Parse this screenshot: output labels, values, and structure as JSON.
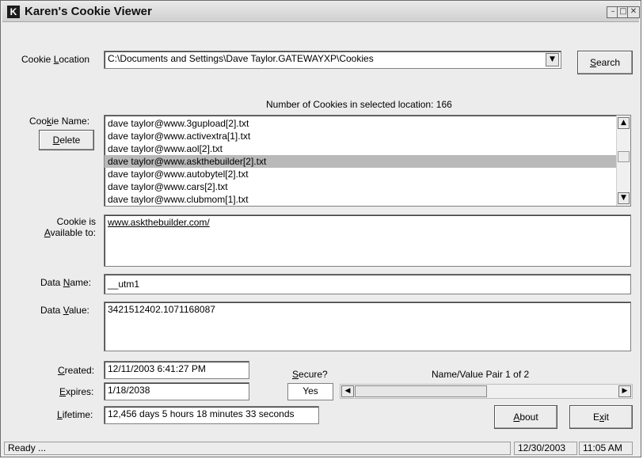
{
  "window": {
    "icon_letter": "K",
    "title": "Karen's Cookie Viewer",
    "controls": [
      "minimize",
      "maximize",
      "close"
    ]
  },
  "location": {
    "label_pre": "Cookie ",
    "label_ul": "L",
    "label_post": "ocation",
    "value": "C:\\Documents and Settings\\Dave Taylor.GATEWAYXP\\Cookies",
    "search_pre": "",
    "search_ul": "S",
    "search_post": "earch"
  },
  "count_text": "Number of Cookies in selected location: 166",
  "cookie_name": {
    "label_pre": "Coo",
    "label_ul": "k",
    "label_post": "ie Name:",
    "delete_ul": "D",
    "delete_post": "elete",
    "items": [
      "dave taylor@www.3gupload[2].txt",
      "dave taylor@www.activextra[1].txt",
      "dave taylor@www.aol[2].txt",
      "dave taylor@www.askthebuilder[2].txt",
      "dave taylor@www.autobytel[2].txt",
      "dave taylor@www.cars[2].txt",
      "dave taylor@www.clubmom[1].txt"
    ],
    "selected_index": 3
  },
  "available": {
    "label_line1": "Cookie is",
    "label_line2_ul": "A",
    "label_line2_post": "vailable to:",
    "value": "www.askthebuilder.com/"
  },
  "data_name": {
    "label_pre": "Data ",
    "label_ul": "N",
    "label_post": "ame:",
    "value": "__utm1"
  },
  "data_value": {
    "label_pre": "Data ",
    "label_ul": "V",
    "label_post": "alue:",
    "value": "3421512402.1071168087"
  },
  "created": {
    "label_ul": "C",
    "label_post": "reated:",
    "value": "12/11/2003 6:41:27 PM"
  },
  "expires": {
    "label_ul": "E",
    "label_post": "xpires:",
    "value": "1/18/2038"
  },
  "lifetime": {
    "label_ul": "L",
    "label_post": "ifetime:",
    "value": "12,456 days 5 hours 18 minutes 33 seconds"
  },
  "secure": {
    "label_ul": "S",
    "label_post": "ecure?",
    "value": "Yes"
  },
  "pair": {
    "label": "Name/Value Pair 1 of 2",
    "current": 1,
    "total": 2
  },
  "buttons": {
    "about_ul": "A",
    "about_post": "bout",
    "exit_pre": "E",
    "exit_ul": "x",
    "exit_post": "it"
  },
  "status": {
    "text": "Ready ...",
    "date": "12/30/2003",
    "time": "11:05 AM"
  },
  "icons": [
    "minimize-icon",
    "maximize-icon",
    "close-icon",
    "dropdown-arrow-icon",
    "scroll-up-icon",
    "scroll-down-icon",
    "scroll-left-icon",
    "scroll-right-icon"
  ]
}
